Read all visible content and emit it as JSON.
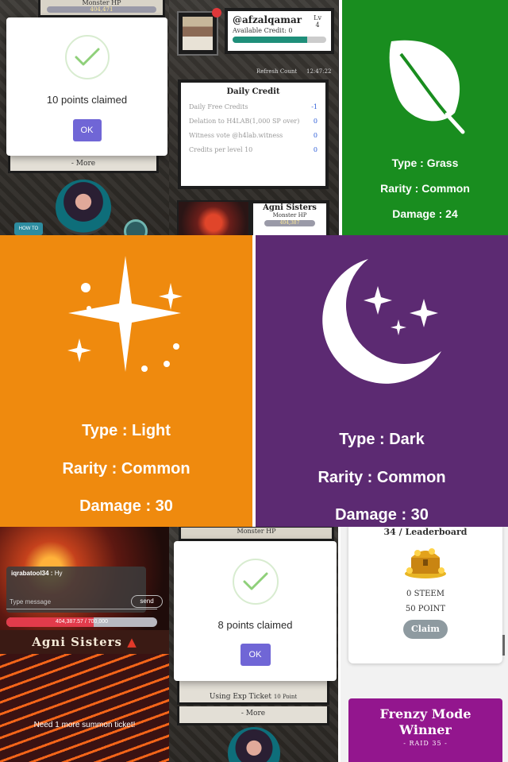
{
  "top_left": {
    "monster_label": "Monster HP",
    "monster_hp": "404,471",
    "more_label": "- More",
    "modal": {
      "message": "10 points claimed",
      "ok_label": "OK"
    },
    "how_to_play": "HOW TO PLAY"
  },
  "top_middle": {
    "username": "@afzalqamar",
    "level_label": "Lv",
    "level_value": "4",
    "available_credit": "Available Credit: 0",
    "credit_fraction": 0.8,
    "refresh_label": "Refresh Count",
    "clock": "12:47:22",
    "daily_credit": {
      "title": "Daily Credit",
      "rows": [
        {
          "label": "Daily Free Credits",
          "value": "-1"
        },
        {
          "label": "Delation to H4LAB(1,000 SP over)",
          "value": "0"
        },
        {
          "label": "Witness vote @h4lab.witness",
          "value": "0"
        },
        {
          "label": "Credits per level 10",
          "value": "0"
        }
      ]
    },
    "boss_card": {
      "name": "Agni Sisters",
      "hp_label": "Monster HP",
      "hp_value": "404,387"
    }
  },
  "grass_card": {
    "type": "Type : Grass",
    "rarity": "Rarity : Common",
    "damage": "Damage : 24",
    "color": "#198d1f",
    "icon": "leaf-icon"
  },
  "light_card": {
    "type": "Type : Light",
    "rarity": "Rarity : Common",
    "damage": "Damage : 30",
    "color": "#ef8a0e",
    "icon": "sparkle-star-icon"
  },
  "dark_card": {
    "type": "Type : Dark",
    "rarity": "Rarity : Common",
    "damage": "Damage : 30",
    "color": "#5c2a72",
    "icon": "crescent-moon-stars-icon"
  },
  "bottom_left": {
    "chat_user": "iqrabatool34 :",
    "chat_text": "Hy",
    "chat_placeholder": "Type message",
    "send_label": "send",
    "boss_hp": "404,387.57 / 700,000",
    "boss_hp_fraction": 0.578,
    "boss_title": "Agni Sisters",
    "need_ticket": "Need 1 more summon ticket!"
  },
  "bottom_middle": {
    "monster_label": "Monster HP",
    "modal": {
      "message": "8 points claimed",
      "ok_label": "OK"
    },
    "exp_ticket": "Using Exp Ticket",
    "exp_point": "10 Point",
    "more_label": "- More"
  },
  "bottom_right": {
    "leaderboard_title": "34 / Leaderboard",
    "steem": "0 STEEM",
    "point": "50 POINT",
    "claim_label": "Claim",
    "frenzy_line1": "Frenzy Mode",
    "frenzy_line2": "Winner",
    "raid": "- RAID 35 -"
  }
}
